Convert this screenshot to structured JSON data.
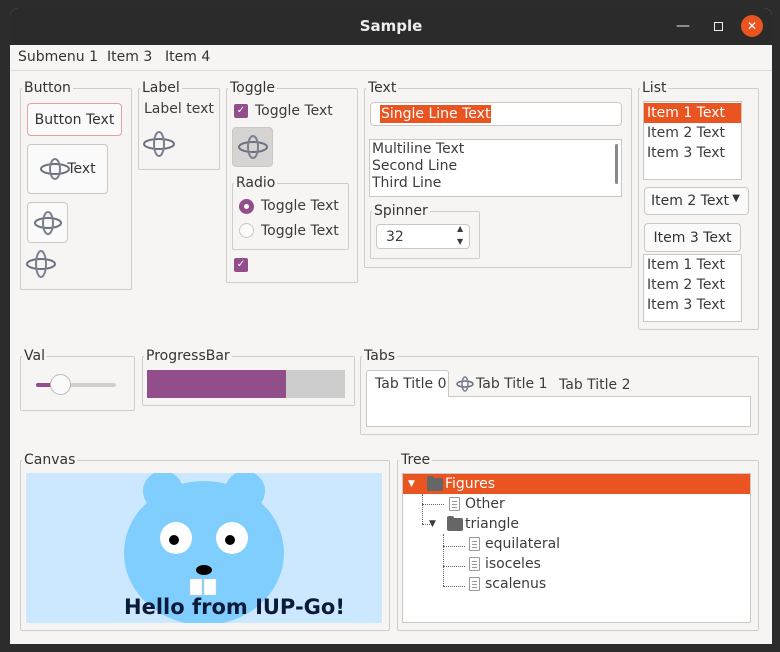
{
  "window": {
    "title": "Sample"
  },
  "menubar": {
    "items": [
      "Submenu 1",
      "Item 3",
      "Item 4"
    ]
  },
  "button_frame": {
    "label": "Button",
    "button_text": "Button Text",
    "icon_button_text": "Text"
  },
  "label_frame": {
    "label": "Label",
    "text": "Label text"
  },
  "toggle_frame": {
    "label": "Toggle",
    "toggle_text": "Toggle Text",
    "radio_label": "Radio",
    "radio1": "Toggle Text",
    "radio2": "Toggle Text"
  },
  "text_frame": {
    "label": "Text",
    "single_line": "Single Line Text",
    "multiline": [
      "Multiline Text",
      "Second Line",
      "Third Line"
    ],
    "spinner_label": "Spinner",
    "spinner_value": "32"
  },
  "list_frame": {
    "label": "List",
    "list1": [
      "Item 1 Text",
      "Item 2 Text",
      "Item 3 Text"
    ],
    "dropdown_value": "Item 2 Text",
    "edit_value": "Item 3 Text",
    "list2": [
      "Item 1 Text",
      "Item 2 Text",
      "Item 3 Text"
    ]
  },
  "val_frame": {
    "label": "Val",
    "value": 0.3
  },
  "progress_frame": {
    "label": "ProgressBar",
    "value": 0.7
  },
  "tabs_frame": {
    "label": "Tabs",
    "tabs": [
      "Tab Title 0",
      "Tab Title 1",
      "Tab Title 2"
    ]
  },
  "canvas_frame": {
    "label": "Canvas",
    "text": "Hello from IUP-Go!"
  },
  "tree_frame": {
    "label": "Tree",
    "nodes": [
      "Figures",
      "Other",
      "triangle",
      "equilateral",
      "isoceles",
      "scalenus"
    ]
  },
  "colors": {
    "accent": "#e95420",
    "toggle": "#924d8b",
    "canvas_bg": "#cce8ff",
    "gopher": "#7fcefd"
  }
}
